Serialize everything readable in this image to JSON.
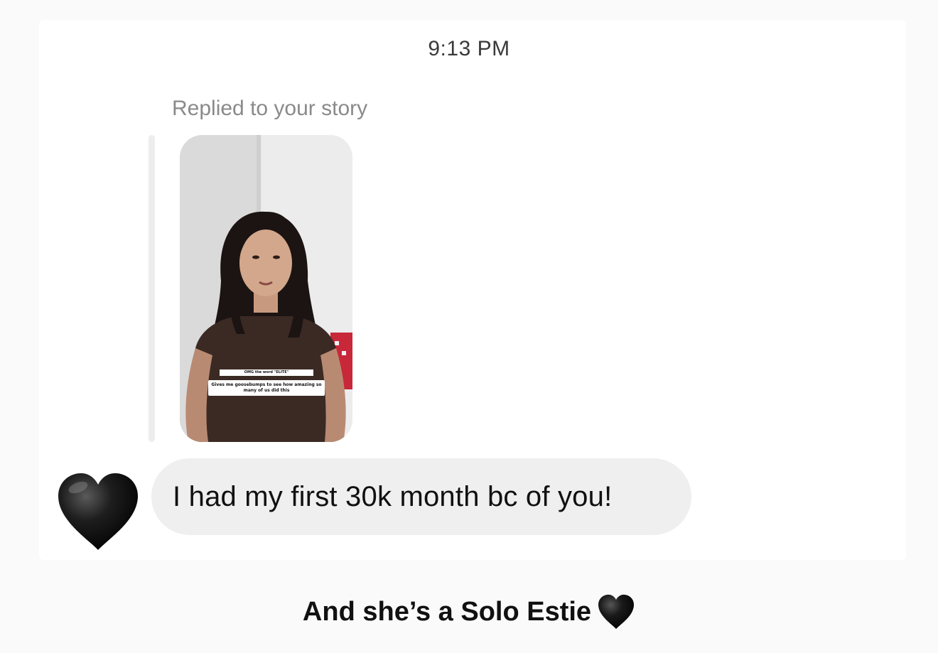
{
  "conversation": {
    "timestamp": "9:13 PM",
    "reply_label": "Replied to your story",
    "story_caption_top": "OMG the word \"ELITE\"",
    "story_caption": "Gives me goosebumps to see how amazing so many of us did this",
    "message_text": "I had my first 30k month bc of you!",
    "avatar_icon": "black-heart-icon"
  },
  "overlay": {
    "caption": "And she’s a Solo Estie",
    "caption_icon": "black-heart-icon"
  },
  "colors": {
    "bubble": "#efefef",
    "heart": "#111111",
    "timestamp": "#3a3a3a",
    "reply_label": "#8a8a8a"
  }
}
